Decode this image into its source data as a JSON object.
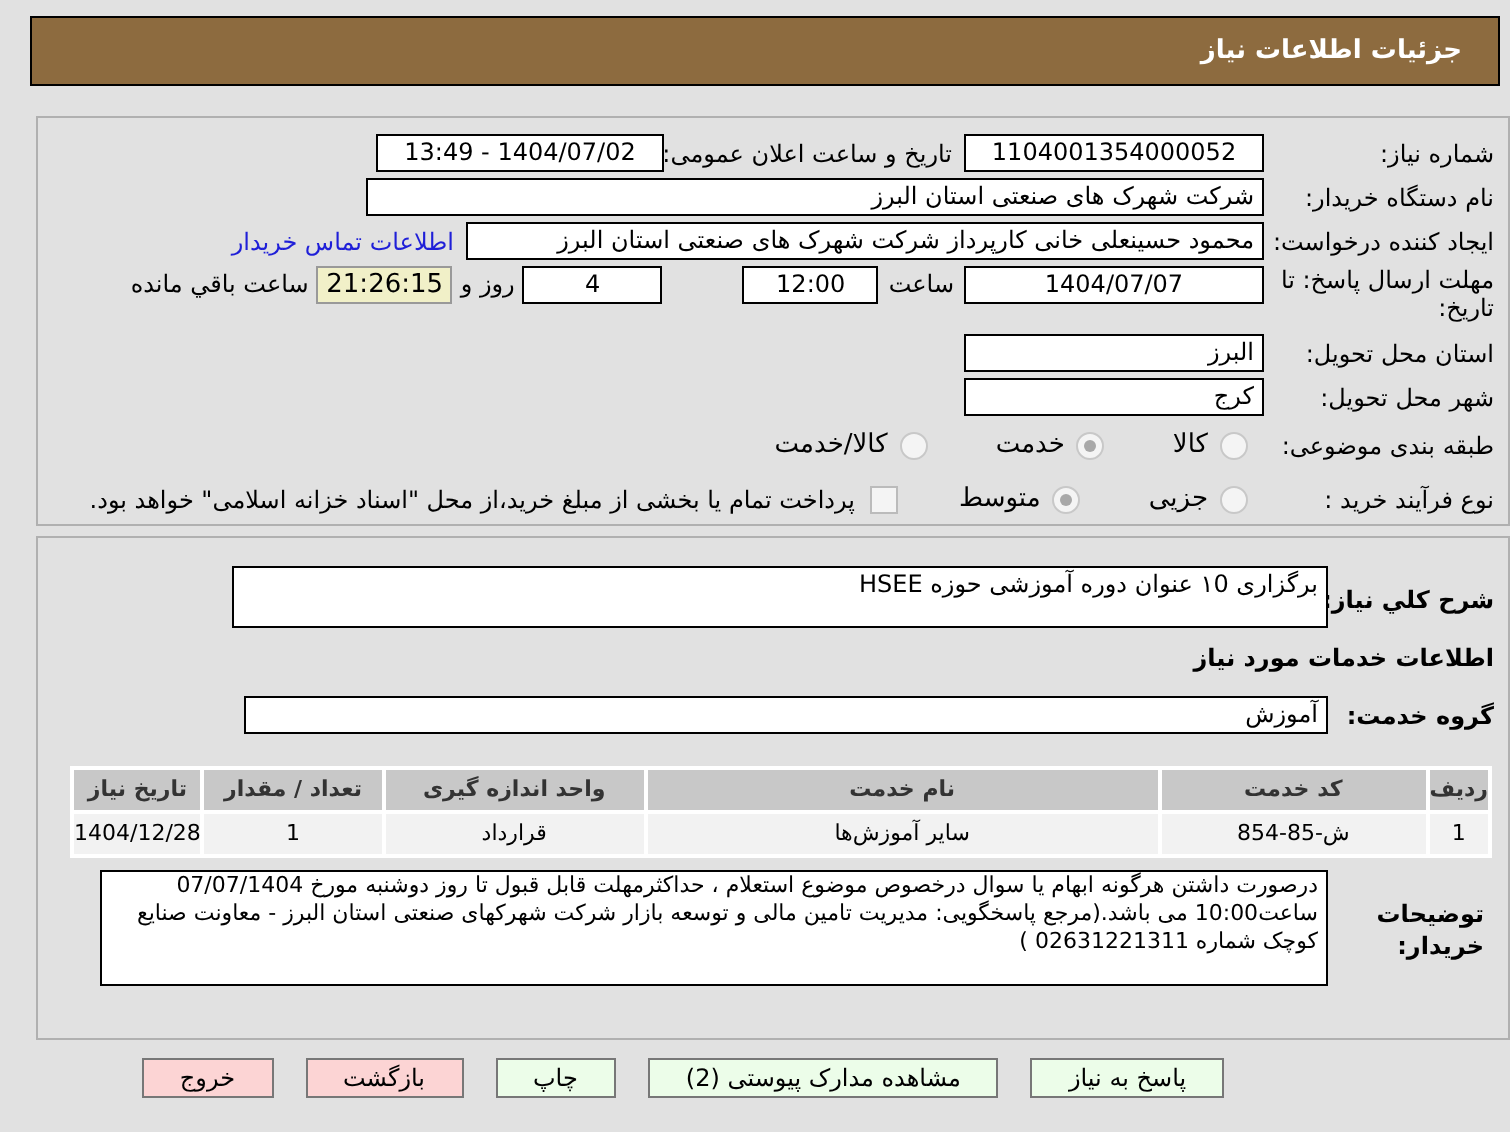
{
  "header": {
    "title": "جزئیات اطلاعات نیاز"
  },
  "need_number": {
    "label": "شماره نیاز:",
    "value": "1104001354000052"
  },
  "announce": {
    "label": "تاریخ و ساعت اعلان عمومی:",
    "value": "1404/07/02 - 13:49"
  },
  "buyer": {
    "label": "نام دستگاه خریدار:",
    "value": "شرکت شهرک های صنعتی استان البرز"
  },
  "requester": {
    "label": "ایجاد کننده درخواست:",
    "value": "محمود حسینعلی خانی کارپرداز شرکت شهرک های صنعتی استان البرز",
    "link": "اطلاعات تماس خریدار"
  },
  "deadline": {
    "label": "مهلت ارسال پاسخ: تا تاریخ:",
    "date": "1404/07/07",
    "time_label": "ساعت",
    "time": "12:00",
    "days": "4",
    "days_label": "روز و",
    "remaining": "21:26:15",
    "remaining_label": "ساعت باقي مانده"
  },
  "province": {
    "label": "استان محل تحویل:",
    "value": "البرز"
  },
  "city": {
    "label": "شهر محل تحویل:",
    "value": "کرج"
  },
  "category": {
    "label": "طبقه بندی موضوعی:",
    "options": [
      {
        "label": "کالا",
        "selected": false
      },
      {
        "label": "خدمت",
        "selected": true
      },
      {
        "label": "کالا/خدمت",
        "selected": false
      }
    ]
  },
  "process": {
    "label": "نوع فرآیند خرید :",
    "options": [
      {
        "label": "جزیی",
        "selected": false
      },
      {
        "label": "متوسط",
        "selected": true
      }
    ],
    "payment": {
      "label": "پرداخت تمام یا بخشی از مبلغ خرید،از محل \"اسناد خزانه اسلامی\" خواهد بود.",
      "checked": false
    }
  },
  "summary": {
    "label": "شرح کلي نیاز:",
    "value": "برگزاری ۱0 عنوان دوره آموزشی حوزه HSEE"
  },
  "services_heading": "اطلاعات خدمات مورد نیاز",
  "service_group": {
    "label": "گروه خدمت:",
    "value": "آموزش"
  },
  "table": {
    "columns": [
      "ردیف",
      "کد خدمت",
      "نام خدمت",
      "واحد اندازه گیری",
      "تعداد / مقدار",
      "تاریخ نیاز"
    ],
    "rows": [
      [
        "1",
        "ش-85-854",
        "سایر آموزش‌ها",
        "قرارداد",
        "1",
        "1404/12/28"
      ]
    ]
  },
  "buyer_notes": {
    "label": "توضیحات خریدار:",
    "value": "درصورت داشتن هرگونه ابهام یا سوال درخصوص موضوع استعلام ، حداکثرمهلت قابل قبول تا روز دوشنبه مورخ 07/07/1404 ساعت10:00  می باشد.(مرجع پاسخگویی: مدیریت تامین مالی و توسعه بازار شرکت شهرکهای صنعتی استان البرز  - معاونت صنایع کوچک شماره 02631221311 )"
  },
  "buttons": [
    {
      "label": "پاسخ به نیاز",
      "kind": "normal"
    },
    {
      "label": "مشاهده مدارک پیوستی (2)",
      "kind": "normal"
    },
    {
      "label": "چاپ",
      "kind": "normal"
    },
    {
      "label": "بازگشت",
      "kind": "danger"
    },
    {
      "label": "خروج",
      "kind": "danger"
    }
  ]
}
